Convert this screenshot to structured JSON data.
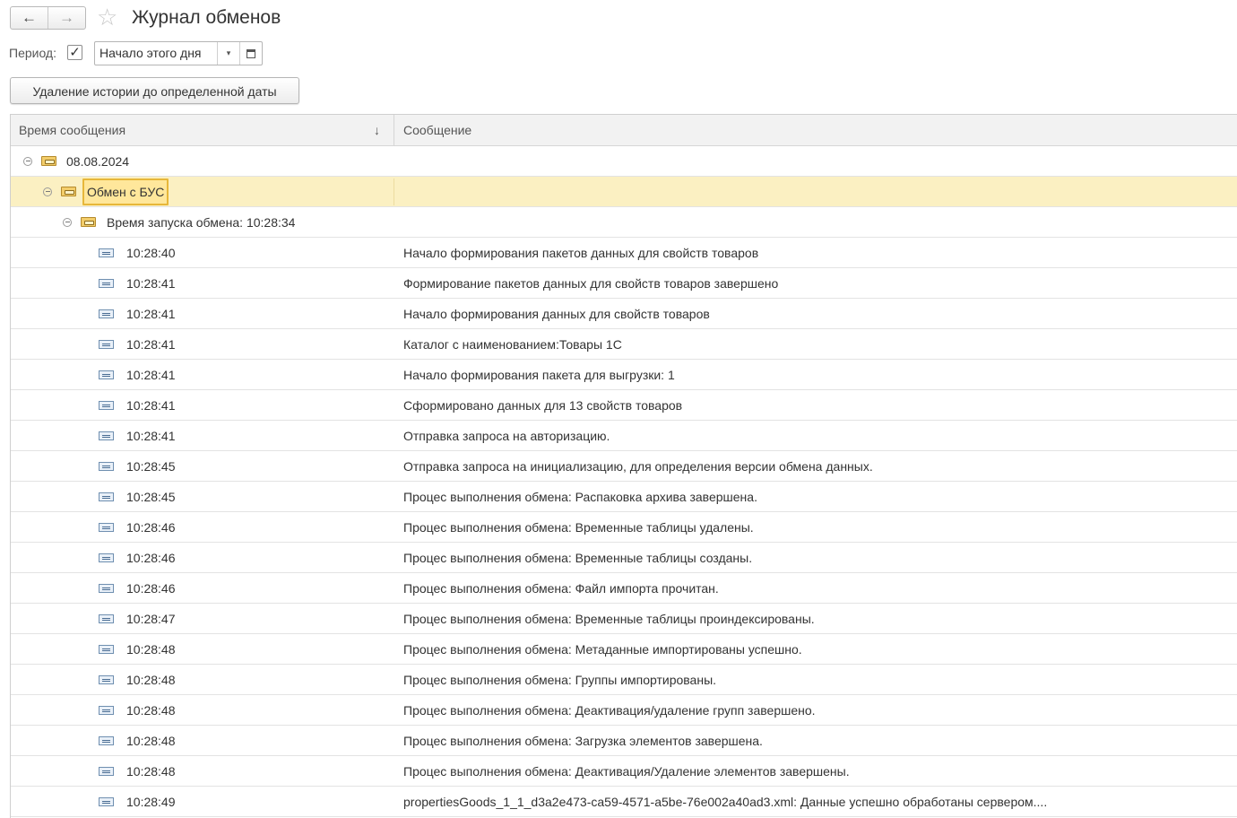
{
  "header": {
    "back_icon": "←",
    "forward_icon": "→",
    "favorite_icon": "☆",
    "title": "Журнал обменов"
  },
  "filter": {
    "period_label": "Период:",
    "period_checked": true,
    "checkmark": "✓",
    "period_value": "Начало этого дня",
    "dropdown_icon": "▾"
  },
  "toolbar": {
    "delete_history_label": "Удаление истории до определенной даты"
  },
  "table": {
    "columns": {
      "time": "Время сообщения",
      "message": "Сообщение",
      "sort_indicator": "↓"
    },
    "groups": {
      "date": "08.08.2024",
      "exchange": "Обмен с БУС",
      "launch": "Время запуска обмена: 10:28:34"
    },
    "rows": [
      {
        "time": "10:28:40",
        "message": "Начало формирования пакетов данных для свойств товаров"
      },
      {
        "time": "10:28:41",
        "message": "Формирование пакетов данных для свойств товаров завершено"
      },
      {
        "time": "10:28:41",
        "message": "Начало формирования данных для свойств товаров"
      },
      {
        "time": "10:28:41",
        "message": "Каталог с наименованием:Товары 1С"
      },
      {
        "time": "10:28:41",
        "message": "Начало формирования пакета для выгрузки: 1"
      },
      {
        "time": "10:28:41",
        "message": "Сформировано данных для 13 свойств товаров"
      },
      {
        "time": "10:28:41",
        "message": "Отправка запроса на авторизацию."
      },
      {
        "time": "10:28:45",
        "message": "Отправка запроса на инициализацию, для определения версии обмена данных."
      },
      {
        "time": "10:28:45",
        "message": "Процес выполнения обмена: Распаковка архива завершена."
      },
      {
        "time": "10:28:46",
        "message": "Процес выполнения обмена: Временные таблицы удалены."
      },
      {
        "time": "10:28:46",
        "message": "Процес выполнения обмена: Временные таблицы созданы."
      },
      {
        "time": "10:28:46",
        "message": "Процес выполнения обмена: Файл импорта прочитан."
      },
      {
        "time": "10:28:47",
        "message": "Процес выполнения обмена: Временные таблицы проиндексированы."
      },
      {
        "time": "10:28:48",
        "message": "Процес выполнения обмена: Метаданные импортированы успешно."
      },
      {
        "time": "10:28:48",
        "message": "Процес выполнения обмена: Группы импортированы."
      },
      {
        "time": "10:28:48",
        "message": "Процес выполнения обмена: Деактивация/удаление групп завершено."
      },
      {
        "time": "10:28:48",
        "message": "Процес выполнения обмена: Загрузка элементов завершена."
      },
      {
        "time": "10:28:48",
        "message": "Процес выполнения обмена: Деактивация/Удаление элементов завершены."
      },
      {
        "time": "10:28:49",
        "message": "propertiesGoods_1_1_d3a2e473-ca59-4571-a5be-76e002a40ad3.xml: Данные успешно обработаны сервером...."
      }
    ]
  }
}
